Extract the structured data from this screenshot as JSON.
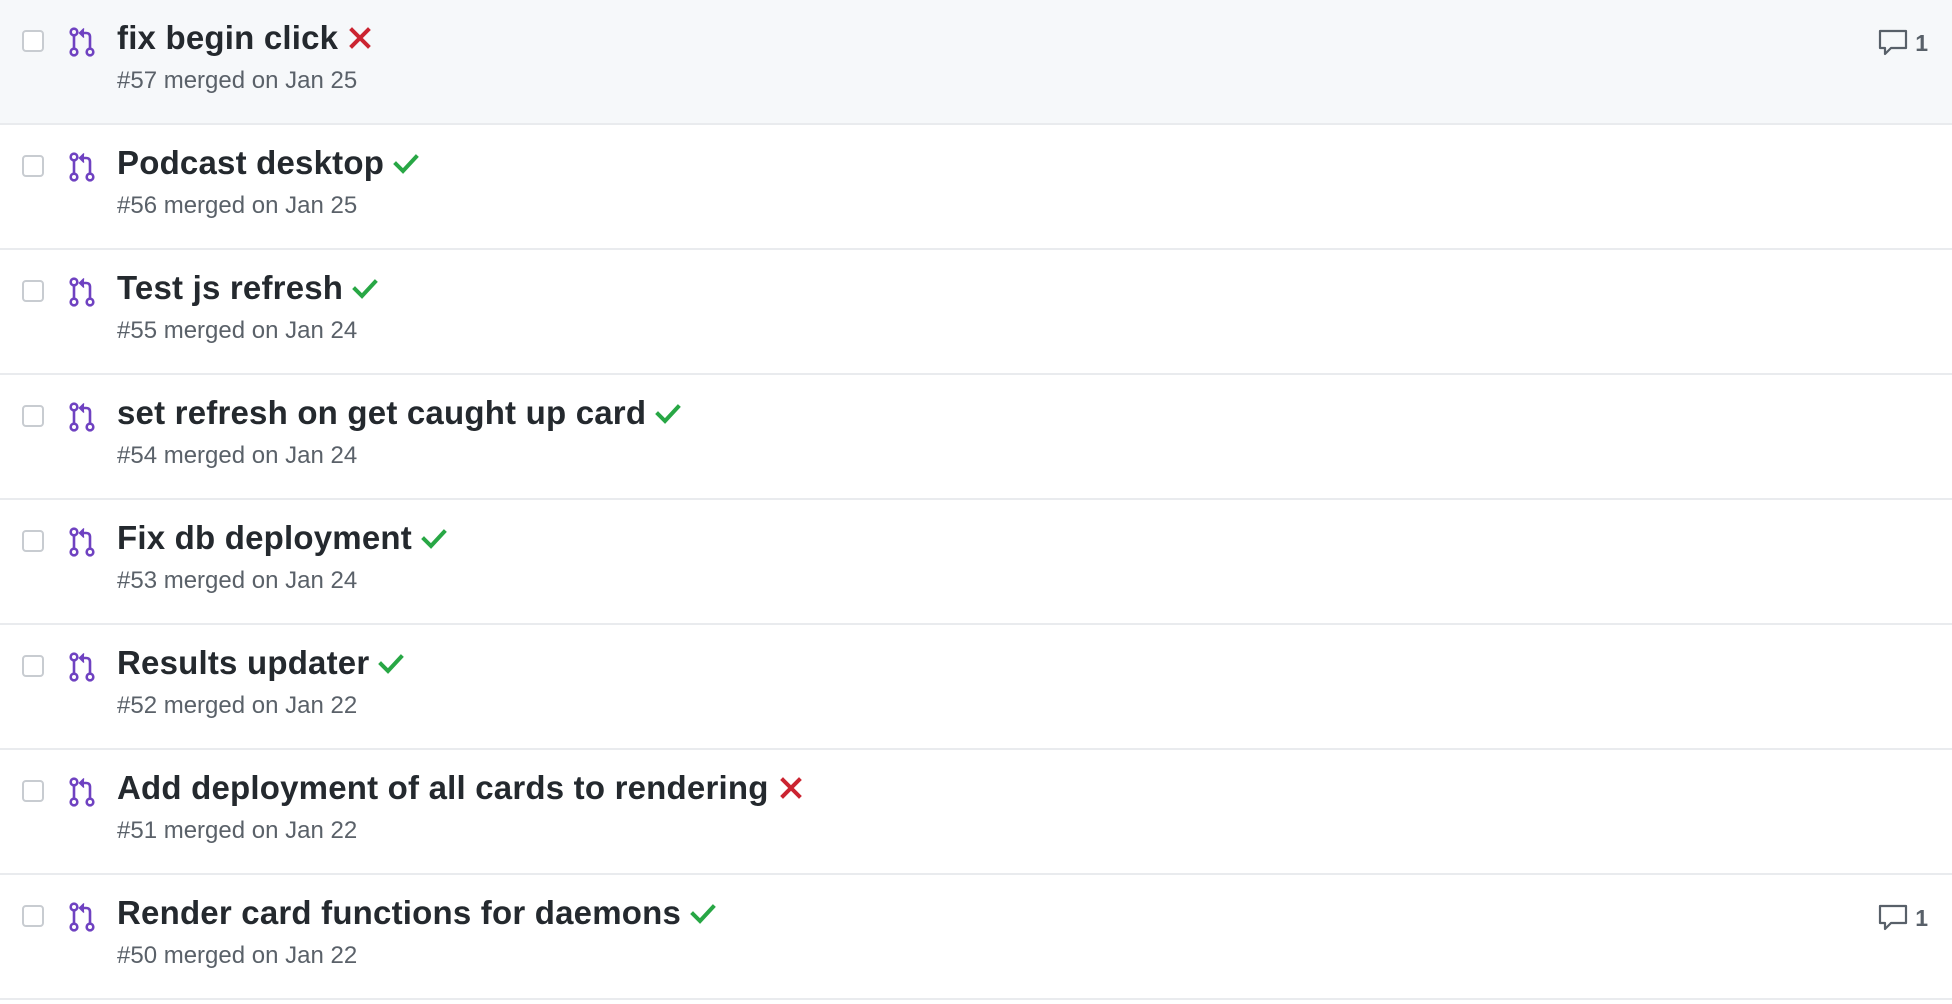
{
  "colors": {
    "merged_icon": "#6f42c1",
    "success": "#28a745",
    "failure": "#cb2431",
    "border": "#e9ebee",
    "hover_bg": "#f6f8fa"
  },
  "pull_requests": [
    {
      "title": "fix begin click",
      "meta": "#57 merged on Jan 25",
      "status": "failure",
      "comments": "1"
    },
    {
      "title": "Podcast desktop",
      "meta": "#56 merged on Jan 25",
      "status": "success",
      "comments": ""
    },
    {
      "title": "Test js refresh",
      "meta": "#55 merged on Jan 24",
      "status": "success",
      "comments": ""
    },
    {
      "title": "set refresh on get caught up card",
      "meta": "#54 merged on Jan 24",
      "status": "success",
      "comments": ""
    },
    {
      "title": "Fix db deployment",
      "meta": "#53 merged on Jan 24",
      "status": "success",
      "comments": ""
    },
    {
      "title": "Results updater",
      "meta": "#52 merged on Jan 22",
      "status": "success",
      "comments": ""
    },
    {
      "title": "Add deployment of all cards to rendering",
      "meta": "#51 merged on Jan 22",
      "status": "failure",
      "comments": ""
    },
    {
      "title": "Render card functions for daemons",
      "meta": "#50 merged on Jan 22",
      "status": "success",
      "comments": "1"
    }
  ]
}
